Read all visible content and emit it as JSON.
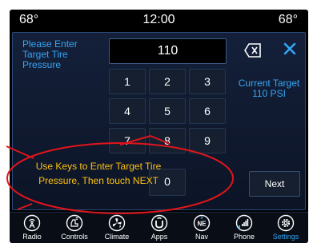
{
  "status_bar": {
    "left_temp": "68°",
    "clock": "12:00",
    "right_temp": "68°"
  },
  "dialog": {
    "prompt": "Please Enter Target Tire Pressure",
    "entry_value": "110",
    "backspace_icon": "backspace-icon",
    "close_icon": "close-icon",
    "current_target_label": "Current Target",
    "current_target_value": "110 PSI",
    "keys": [
      "1",
      "2",
      "3",
      "4",
      "5",
      "6",
      "7",
      "8",
      "9",
      "0"
    ],
    "next_label": "Next"
  },
  "annotation": {
    "line1": "Use Keys to Enter Target Tire",
    "line2": "Pressure, Then touch NEXT",
    "color": "#ffc20e",
    "outline_color": "#e0151b"
  },
  "nav": {
    "items": [
      {
        "label": "Radio",
        "icon": "radio-icon",
        "active": false
      },
      {
        "label": "Controls",
        "icon": "controls-icon",
        "active": false
      },
      {
        "label": "Climate",
        "icon": "climate-icon",
        "active": false
      },
      {
        "label": "Apps",
        "icon": "apps-icon",
        "active": false
      },
      {
        "label": "Nav",
        "icon": "nav-compass-icon",
        "compass_text": "NE",
        "active": false
      },
      {
        "label": "Phone",
        "icon": "phone-icon",
        "active": false
      },
      {
        "label": "Settings",
        "icon": "settings-gear-icon",
        "active": true
      }
    ]
  },
  "colors": {
    "accent": "#35a6f5",
    "background": "#000000",
    "panel": "#14203a"
  }
}
